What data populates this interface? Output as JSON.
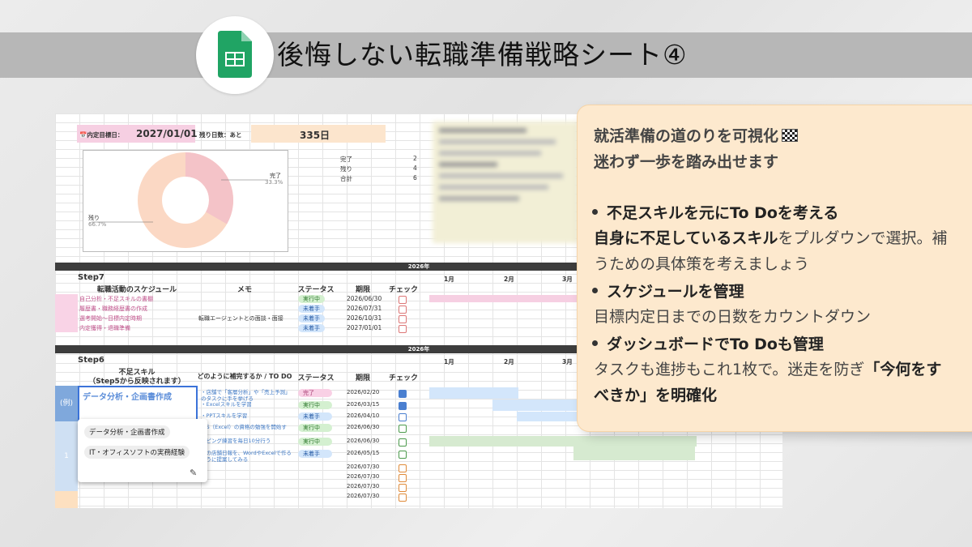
{
  "title": "後悔しない転職準備戦略シート④",
  "sheet": {
    "target_date_label": "📅内定目標日：",
    "target_date": "2027/01/01",
    "remaining_label": "残り日数：あと",
    "remaining_days": "335日",
    "summary": [
      {
        "label": "完了",
        "value": "2"
      },
      {
        "label": "残り",
        "value": "4"
      },
      {
        "label": "合計",
        "value": "6"
      }
    ],
    "chart": {
      "done_label": "完了",
      "done_pct": "33.3%",
      "left_label": "残り",
      "left_pct": "66.7%",
      "done_fraction": 0.333
    },
    "year_band": "2026年",
    "months": [
      "1月",
      "2月",
      "3月"
    ],
    "step7": {
      "label": "Step7",
      "headers": [
        "転職活動のスケジュール",
        "メモ",
        "ステータス",
        "期限",
        "チェック"
      ],
      "rows": [
        {
          "task": "自己分析・不足スキルの書棚",
          "memo": "",
          "status": "実行中",
          "deadline": "2026/06/30"
        },
        {
          "task": "履歴書・職務経歴書の作成",
          "memo": "",
          "status": "未着手",
          "deadline": "2026/07/31"
        },
        {
          "task": "選考開始〜目標内定時期",
          "memo": "転職エージェントとの面談・面接",
          "status": "未着手",
          "deadline": "2026/10/31"
        },
        {
          "task": "内定獲得・退職準備",
          "memo": "",
          "status": "未着手",
          "deadline": "2027/01/01"
        }
      ]
    },
    "step6": {
      "label": "Step6",
      "col1_line1": "不足スキル",
      "col1_line2": "（Step5から反映されます）",
      "col2": "どのように補完するか / TO DO",
      "col3": "ステータス",
      "col4": "期限",
      "col5": "チェック",
      "example_tag": "(例)",
      "example_skill": "データ分析・企画書作成",
      "row_number": "1",
      "rows": [
        {
          "todo": "・店舗で「客層分析」や「売上予測」のタスクに手を挙げる",
          "status": "完了",
          "deadline": "2026/02/20",
          "checked": true
        },
        {
          "todo": "・Excelスキルを学習",
          "status": "実行中",
          "deadline": "2026/03/15",
          "checked": true
        },
        {
          "todo": "・PPTスキルを学習",
          "status": "未着手",
          "deadline": "2026/04/10",
          "checked": false
        },
        {
          "todo": "・S（Excel）の資格の勉強を開始す",
          "status": "実行中",
          "deadline": "2026/06/30",
          "checked": false
        },
        {
          "todo": "・ピング練習を毎日10分行う",
          "status": "実行中",
          "deadline": "2026/06/30",
          "checked": false
        },
        {
          "todo": "・の店舗日報を、WordやExcelで作るように提案してみる",
          "status": "未着手",
          "deadline": "2026/05/15",
          "checked": false
        },
        {
          "todo": "",
          "status": "",
          "deadline": "2026/07/30",
          "checked": false
        },
        {
          "todo": "",
          "status": "",
          "deadline": "2026/07/30",
          "checked": false
        },
        {
          "todo": "",
          "status": "",
          "deadline": "2026/07/30",
          "checked": false
        },
        {
          "todo": "",
          "status": "",
          "deadline": "2026/07/30",
          "checked": false
        }
      ]
    },
    "dropdown": {
      "options": [
        "データ分析・企画書作成",
        "IT・オフィスソフトの実務経験"
      ]
    }
  },
  "callout": {
    "heading_line1": "就活準備の道のりを可視化",
    "heading_line2": "迷わず一歩を踏み出せます",
    "bullet1": "不足スキルを元にTo Doを考える",
    "bullet1_body_bold": "自身に不足しているスキル",
    "bullet1_body_rest": "をプルダウンで選択。補うための具体策を考えましょう",
    "bullet2": "スケジュールを管理",
    "bullet2_body": "目標内定日までの日数をカウントダウン",
    "bullet3": "ダッシュボードでTo Doも管理",
    "bullet3_body": "タスクも進捗もこれ1枚で。迷走を防ぎ",
    "bullet3_body_bold": "「今何をすべきか」を明確化"
  }
}
